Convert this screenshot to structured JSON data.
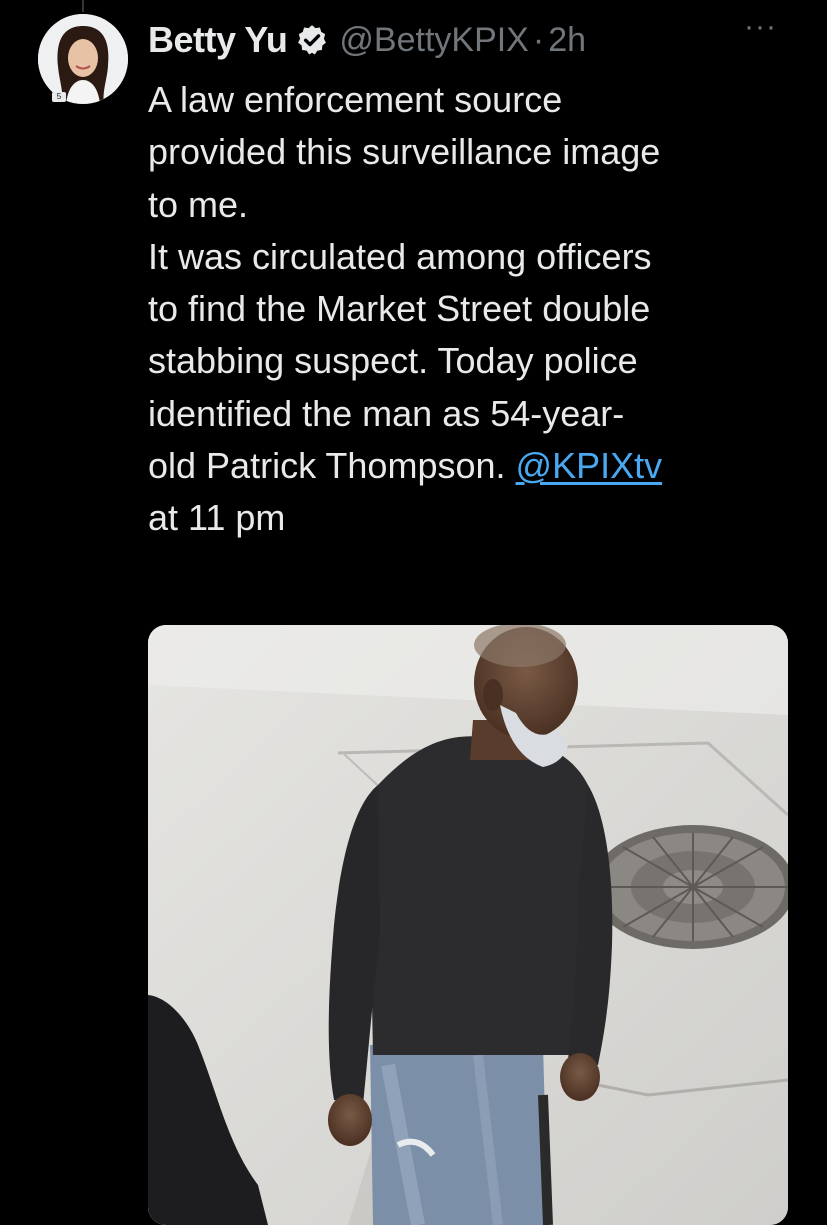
{
  "tweet": {
    "author": {
      "display_name": "Betty Yu",
      "handle": "@BettyKPIX",
      "verified": true,
      "avatar_badge_text": "5"
    },
    "separator": "·",
    "time": "2h",
    "more_label": "···",
    "text_lines": [
      "A law enforcement source",
      "provided this surveillance image",
      "to me.",
      "It was circulated among officers",
      "to find the Market Street double",
      "stabbing suspect. Today police",
      "identified the man as 54-year-",
      "old Patrick Thompson."
    ],
    "mention": "@KPIXtv",
    "final_line": "at 11 pm",
    "media": {
      "type": "photo",
      "subject": "surveillance image of a man in a dark long-sleeve shirt and jeans on a sidewalk"
    }
  },
  "colors": {
    "background": "#000000",
    "text": "#e7e9ea",
    "secondary_text": "#71767b",
    "link": "#4aa8f0",
    "verified_badge": "#e7e9ea"
  },
  "icons": [
    "verified-badge-icon",
    "more-options-icon"
  ]
}
